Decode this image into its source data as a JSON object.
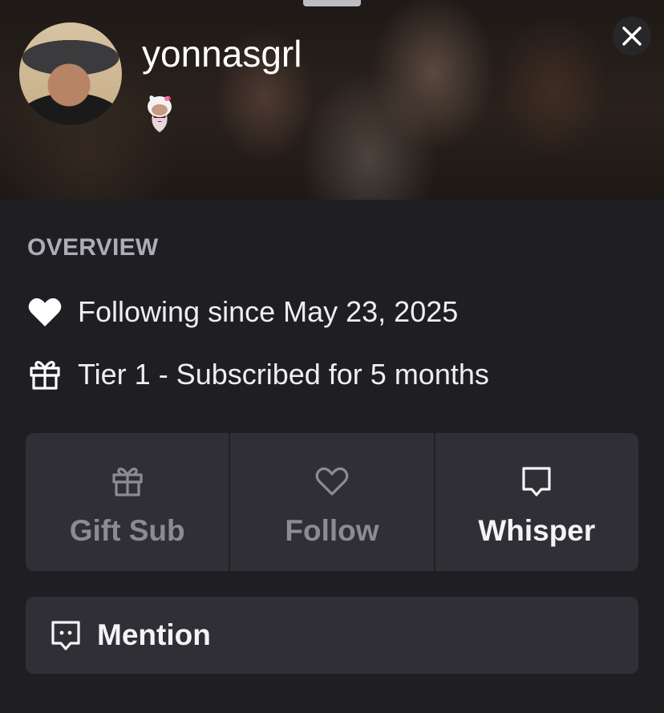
{
  "profile": {
    "username": "yonnasgrl"
  },
  "overview": {
    "heading": "OVERVIEW",
    "following_text": "Following since May 23, 2025",
    "subscription_text": "Tier 1 - Subscribed for 5 months"
  },
  "actions": {
    "gift_sub_label": "Gift Sub",
    "follow_label": "Follow",
    "whisper_label": "Whisper",
    "mention_label": "Mention"
  },
  "icons": {
    "heart": "heart-icon",
    "gift": "gift-icon",
    "heart_outline": "heart-outline-icon",
    "whisper": "chat-bubble-icon",
    "mention": "chat-bubble-dots-icon",
    "close": "close-icon"
  },
  "colors": {
    "background": "#1f1f23",
    "card": "#2f2f35",
    "muted_text": "#adadb8",
    "disabled_text": "#8b8b93"
  }
}
